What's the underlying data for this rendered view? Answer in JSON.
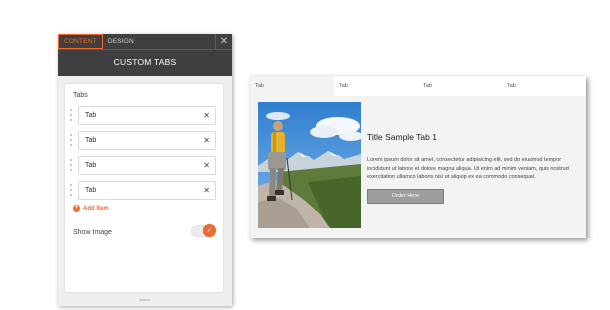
{
  "editor": {
    "tabs": [
      {
        "label": "CONTENT",
        "active": true
      },
      {
        "label": "DESIGN",
        "active": false
      }
    ],
    "close_icon": "close-icon",
    "title": "CUSTOM TABS",
    "tabs_section_label": "Tabs",
    "items": [
      {
        "value": "Tab"
      },
      {
        "value": "Tab"
      },
      {
        "value": "Tab"
      },
      {
        "value": "Tab"
      }
    ],
    "add_item_label": "Add Item",
    "show_image_label": "Show Image",
    "show_image_enabled": true,
    "accent_color": "#ef6a2f",
    "header_color": "#3d3f41"
  },
  "preview": {
    "tabs": [
      {
        "label": "Tab",
        "active": true
      },
      {
        "label": "Tab",
        "active": false
      },
      {
        "label": "Tab",
        "active": false
      },
      {
        "label": "Tab",
        "active": false
      }
    ],
    "content_title": "Title Sample Tab 1",
    "content_body": "Lorem ipsum dolor sit amet, consectetur adipisicing elit, sed do eiusmod tempor incididunt ut labore et dolore magna aliqua. Ut enim ad minim veniam, quis nostrud exercitation ullamco laboris nisi ut aliquip ex ea commodo consequat.",
    "button_label": "Order Here",
    "button_color": "#9d9d9d"
  }
}
